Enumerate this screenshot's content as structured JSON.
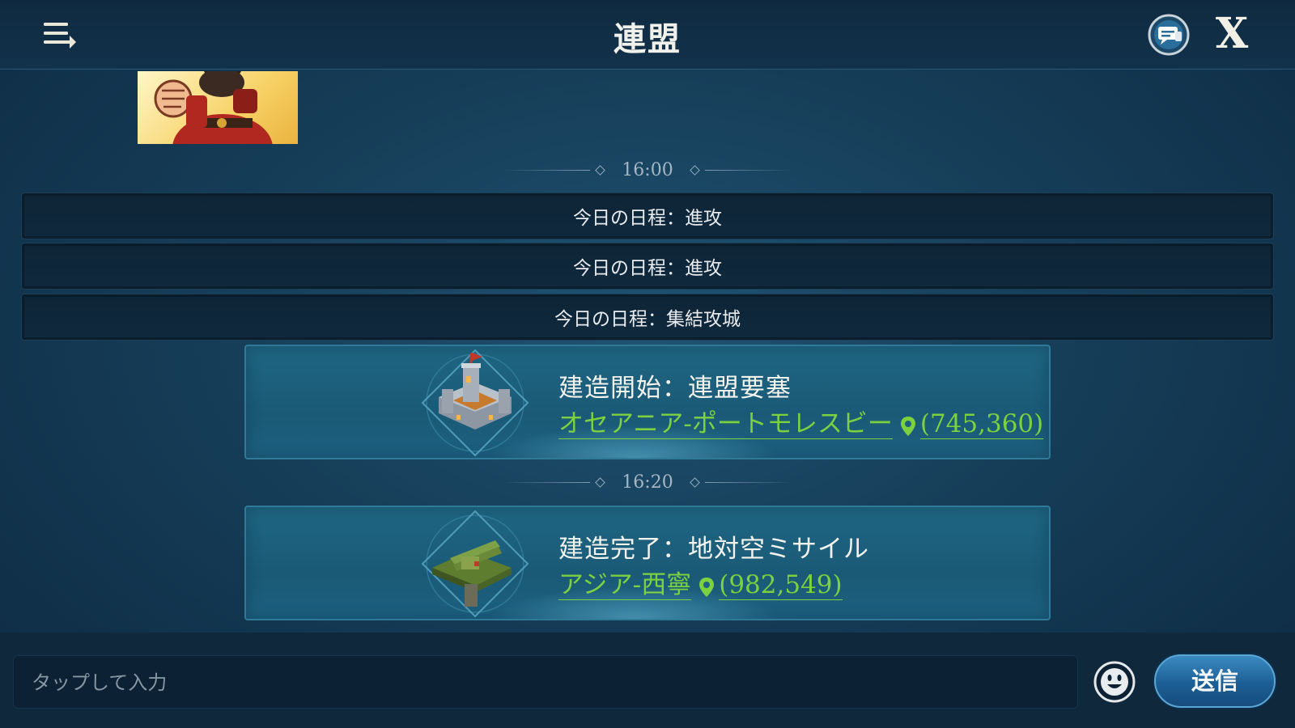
{
  "header": {
    "title": "連盟",
    "menu_icon": "menu-arrow-icon",
    "chat_icon": "chat-bubble-icon",
    "close_label": "X"
  },
  "messages": {
    "time_1": "16:00",
    "schedules": [
      "今日の日程：進攻",
      "今日の日程：進攻",
      "今日の日程：集結攻城"
    ],
    "events": [
      {
        "title": "建造開始：連盟要塞",
        "region": "オセアニア-ポートモレスビー",
        "coords": "(745,360)",
        "icon": "fortress-icon"
      },
      {
        "title": "建造完了：地対空ミサイル",
        "region": "アジア-西寧",
        "coords": "(982,549)",
        "icon": "sam-launcher-icon"
      }
    ],
    "time_2": "16:20"
  },
  "composer": {
    "placeholder": "タップして入力",
    "emoji_icon": "smiley-icon",
    "send_label": "送信"
  },
  "colors": {
    "link_green": "#7bd13f",
    "send_blue": "#1d5f95"
  }
}
